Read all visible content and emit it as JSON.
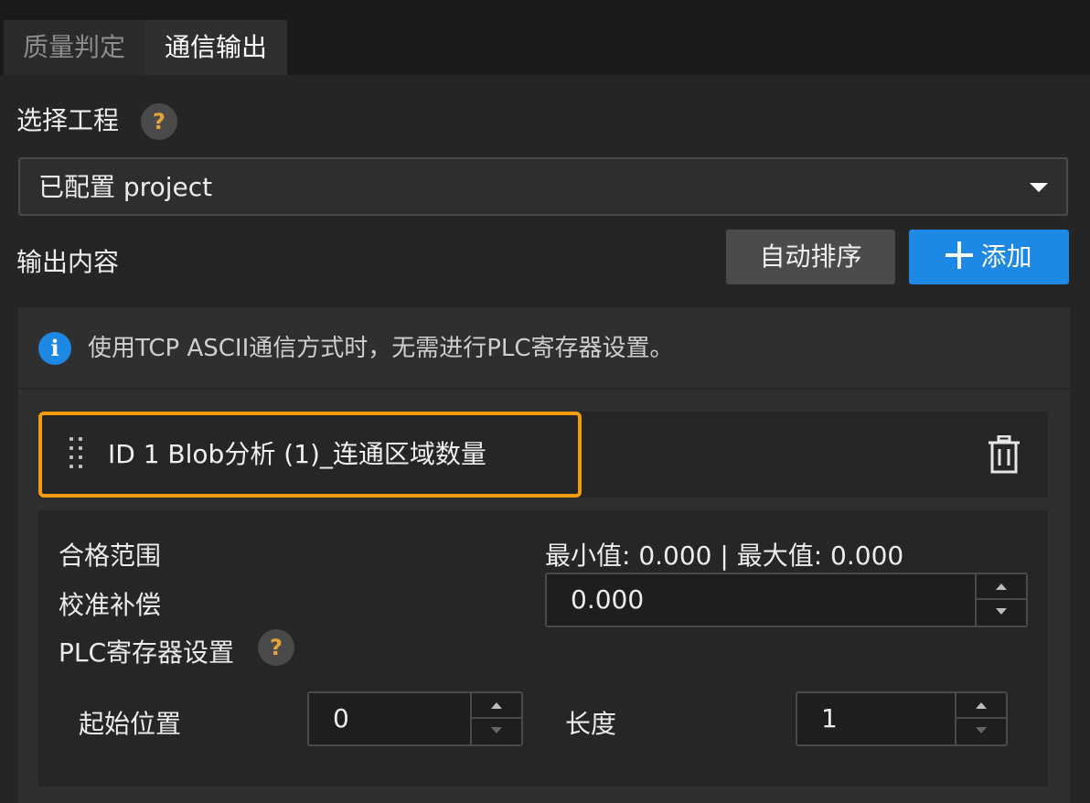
{
  "tabs": [
    {
      "label": "质量判定",
      "active": false
    },
    {
      "label": "通信输出",
      "active": true
    }
  ],
  "select_project": {
    "label": "选择工程",
    "help_icon": "question-icon",
    "value": "已配置 project"
  },
  "output": {
    "label": "输出内容",
    "auto_sort_label": "自动排序",
    "add_label": "添加"
  },
  "info": {
    "icon": "info-icon",
    "text": "使用TCP ASCII通信方式时，无需进行PLC寄存器设置。"
  },
  "item": {
    "title": "ID 1  Blob分析 (1)_连通区域数量",
    "range_label": "合格范围",
    "range_value": "最小值: 0.000 | 最大值: 0.000",
    "calib_label": "校准补偿",
    "calib_value": "0.000",
    "plc_label": "PLC寄存器设置",
    "start_label": "起始位置",
    "start_value": "0",
    "length_label": "长度",
    "length_value": "1"
  },
  "colors": {
    "accent_blue": "#1e88e5",
    "highlight_orange": "#f39c12",
    "help_orange": "#e8a23a"
  }
}
